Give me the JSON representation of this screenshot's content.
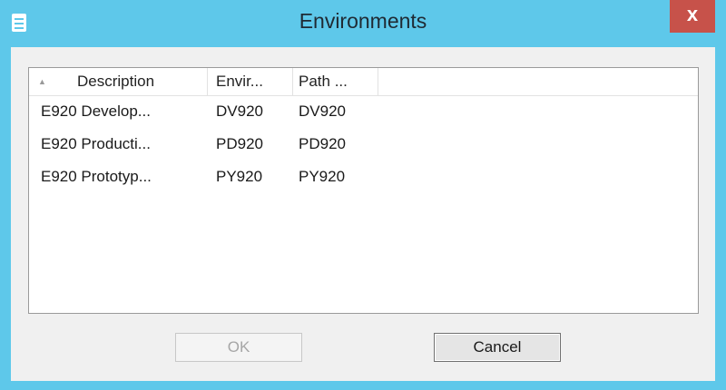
{
  "window": {
    "title": "Environments",
    "close_label": "x"
  },
  "list": {
    "columns": [
      {
        "label": "Description",
        "sort": "ascending"
      },
      {
        "label": "Envir..."
      },
      {
        "label": "Path ..."
      }
    ],
    "rows": [
      {
        "description": "E920 Develop...",
        "environment": "DV920",
        "path": "DV920"
      },
      {
        "description": "E920 Producti...",
        "environment": "PD920",
        "path": "PD920"
      },
      {
        "description": "E920 Prototyp...",
        "environment": "PY920",
        "path": "PY920"
      }
    ]
  },
  "buttons": {
    "ok_label": "OK",
    "cancel_label": "Cancel"
  },
  "colors": {
    "titlebar": "#5ec8ea",
    "close_button": "#c7524a"
  }
}
